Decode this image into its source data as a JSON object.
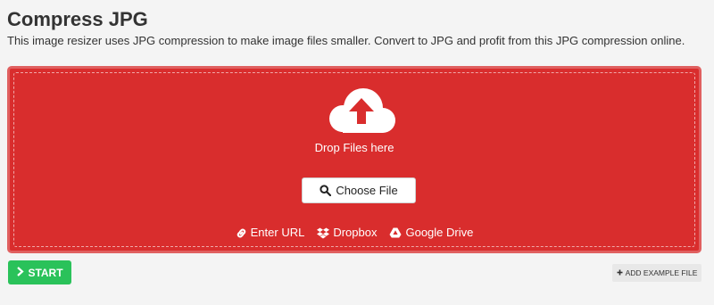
{
  "header": {
    "title": "Compress JPG",
    "description": "This image resizer uses JPG compression to make image files smaller. Convert to JPG and profit from this JPG compression online."
  },
  "dropzone": {
    "icon": "cloud-upload-icon",
    "drop_text": "Drop Files here",
    "choose_file_label": "Choose File",
    "sources": [
      {
        "label": "Enter URL",
        "icon": "link-icon"
      },
      {
        "label": "Dropbox",
        "icon": "dropbox-icon"
      },
      {
        "label": "Google Drive",
        "icon": "google-drive-icon"
      }
    ],
    "color": "#d92d2d"
  },
  "actions": {
    "start_label": "START",
    "start_color": "#2ac25a",
    "add_example_label": "ADD EXAMPLE FILE"
  }
}
